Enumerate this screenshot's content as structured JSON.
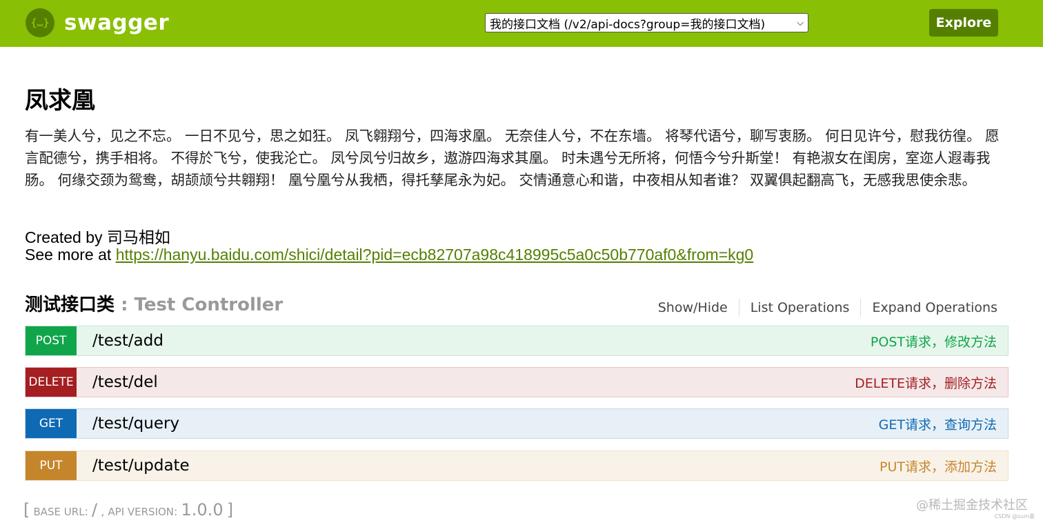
{
  "header": {
    "logo_icon_glyph": "{…}",
    "logo_text": "swagger",
    "api_select_value": "我的接口文档 (/v2/api-docs?group=我的接口文档)",
    "explore_label": "Explore"
  },
  "info": {
    "title": "凤求凰",
    "description": "有一美人兮，见之不忘。 一日不见兮，思之如狂。 凤飞翱翔兮，四海求凰。 无奈佳人兮，不在东墙。 将琴代语兮，聊写衷肠。 何日见许兮，慰我彷徨。 愿言配德兮，携手相将。 不得於飞兮，使我沦亡。 凤兮凤兮归故乡，遨游四海求其凰。 时未遇兮无所将，何悟今兮升斯堂！ 有艳淑女在闺房，室迩人遐毒我肠。 何缘交颈为鸳鸯，胡颉颃兮共翱翔！ 凰兮凰兮从我栖，得托孳尾永为妃。 交情通意心和谐，中夜相从知者谁？ 双翼俱起翻高飞，无感我思使余悲。",
    "created_prefix": "Created by ",
    "author": "司马相如",
    "see_more_prefix": "See more at ",
    "see_more_url": "https://hanyu.baidu.com/shici/detail?pid=ecb82707a98c418995c5a0c50b770af0&from=kg0"
  },
  "resource": {
    "name": "测试接口类",
    "separator": " : ",
    "description": "Test Controller",
    "actions": [
      "Show/Hide",
      "List Operations",
      "Expand Operations"
    ]
  },
  "operations": [
    {
      "method": "POST",
      "path": "/test/add",
      "summary": "POST请求，修改方法",
      "color": "#10a54a",
      "bg": "#e7f6ec",
      "border": "#c3e8d1"
    },
    {
      "method": "DELETE",
      "path": "/test/del",
      "summary": "DELETE请求，删除方法",
      "color": "#a41e22",
      "bg": "#f5e8e8",
      "border": "#e8c6c7"
    },
    {
      "method": "GET",
      "path": "/test/query",
      "summary": "GET请求，查询方法",
      "color": "#0f6ab4",
      "bg": "#e7f0f7",
      "border": "#c3d9ec"
    },
    {
      "method": "PUT",
      "path": "/test/update",
      "summary": "PUT请求，添加方法",
      "color": "#c5862b",
      "bg": "#f9f2e9",
      "border": "#f0e0ca"
    }
  ],
  "footer": {
    "open_bracket": "[",
    "base_url_label": "base url",
    "base_url_value": "/",
    "api_version_label": "api version",
    "api_version_value": "1.0.0",
    "close_bracket": "]",
    "watermark": "@稀土掘金技术社区",
    "watermark_small": "CSDN @sum墨"
  }
}
